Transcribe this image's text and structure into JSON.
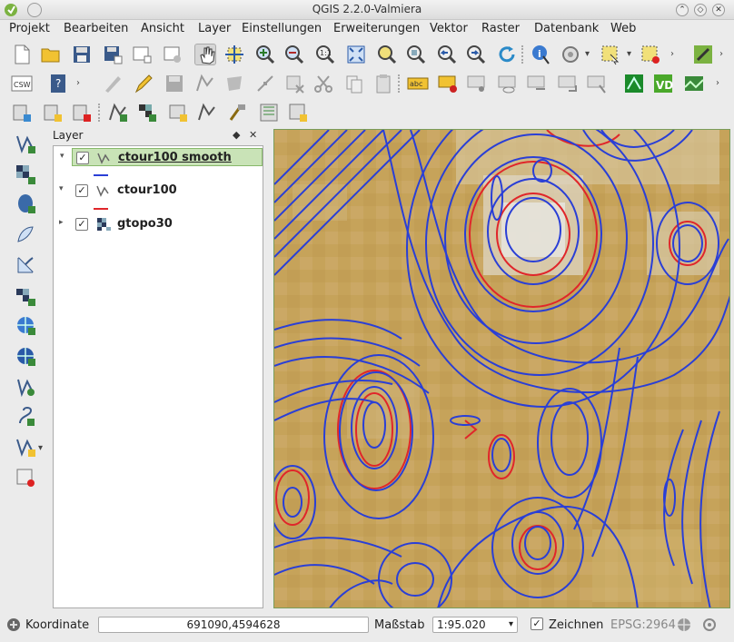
{
  "window": {
    "title": "QGIS 2.2.0-Valmiera",
    "controls": [
      "chevron-up",
      "restore",
      "close"
    ]
  },
  "menu": [
    {
      "label": "Projekt",
      "mnemonic": "P"
    },
    {
      "label": "Bearbeiten",
      "mnemonic": "B"
    },
    {
      "label": "Ansicht",
      "mnemonic": "A"
    },
    {
      "label": "Layer",
      "mnemonic": "L"
    },
    {
      "label": "Einstellungen",
      "mnemonic": "E"
    },
    {
      "label": "Erweiterungen",
      "mnemonic": "r"
    },
    {
      "label": "Vektor",
      "mnemonic": "V"
    },
    {
      "label": "Raster",
      "mnemonic": "R"
    },
    {
      "label": "Datenbank",
      "mnemonic": "D"
    },
    {
      "label": "Web",
      "mnemonic": "W"
    }
  ],
  "toolbar_row1": [
    "new-project-icon",
    "open-project-icon",
    "save-project-icon",
    "save-as-icon",
    "new-print-composer-icon",
    "composer-manager-icon",
    "pan-icon",
    "pan-to-selection-icon",
    "zoom-in-icon",
    "zoom-out-icon",
    "zoom-native-icon",
    "zoom-full-icon",
    "zoom-to-selection-icon",
    "zoom-to-layer-icon",
    "zoom-last-icon",
    "zoom-next-icon",
    "refresh-icon",
    "identify-icon",
    "measure-icon",
    "select-features-icon",
    "deselect-icon",
    "python-console-icon"
  ],
  "toolbar_row2": {
    "csw_label": "CSW",
    "icons": [
      "csw-icon",
      "help-icon",
      "current-edits-icon",
      "toggle-editing-icon",
      "save-edits-icon",
      "add-feature-icon",
      "move-feature-icon",
      "node-tool-icon",
      "delete-selected-icon",
      "cut-icon",
      "copy-icon",
      "paste-icon",
      "label-icon",
      "label-pin-icon",
      "label-show-hide-icon",
      "label-move-icon",
      "label-rotate-icon",
      "label-change-icon",
      "grass-tools-icon",
      "vd-icon",
      "raster-image-icon"
    ],
    "label_badge": "abc"
  },
  "toolbar_row3": [
    "add-delimited-text-icon",
    "add-spatialite-icon",
    "new-layer-icon",
    "add-vector-icon",
    "add-raster-icon",
    "add-postgis-icon",
    "add-wms-icon",
    "add-wfs-icon",
    "add-mssql-icon",
    "add-oracle-icon"
  ],
  "left_toolbar": [
    "add-vector-layer-icon",
    "add-raster-layer-icon",
    "add-postgis-layer-icon",
    "add-spatialite-layer-icon",
    "add-mssql-layer-icon",
    "add-oracle-layer-icon",
    "add-wms-layer-icon",
    "add-wcs-layer-icon",
    "add-wfs-layer-icon",
    "new-shapefile-icon",
    "new-spatialite-icon",
    "remove-layer-icon"
  ],
  "panel": {
    "title": "Layer",
    "float_button": "◆",
    "close_button": "✕"
  },
  "layers": [
    {
      "name": "ctour100 smooth",
      "checked": true,
      "selected": true,
      "expanded": true,
      "type": "vector",
      "legend_color": "#2a3fd6"
    },
    {
      "name": "ctour100",
      "checked": true,
      "selected": false,
      "expanded": true,
      "type": "vector",
      "legend_color": "#e0262a"
    },
    {
      "name": "gtopo30",
      "checked": true,
      "selected": false,
      "expanded": false,
      "type": "raster"
    }
  ],
  "status": {
    "coord_label": "Koordinate",
    "coord_value": "691090,4594628",
    "scale_label": "Maßstab",
    "scale_value": "1:95.020",
    "render_label": "Zeichnen",
    "render_checked": true,
    "crs_label": "EPSG:2964"
  },
  "colors": {
    "selected_row": "#c9e3b7",
    "contour_smooth": "#2a3fd6",
    "contour_raw": "#e0262a",
    "raster_base": "#c9a860",
    "raster_high": "#e6e3dc"
  }
}
